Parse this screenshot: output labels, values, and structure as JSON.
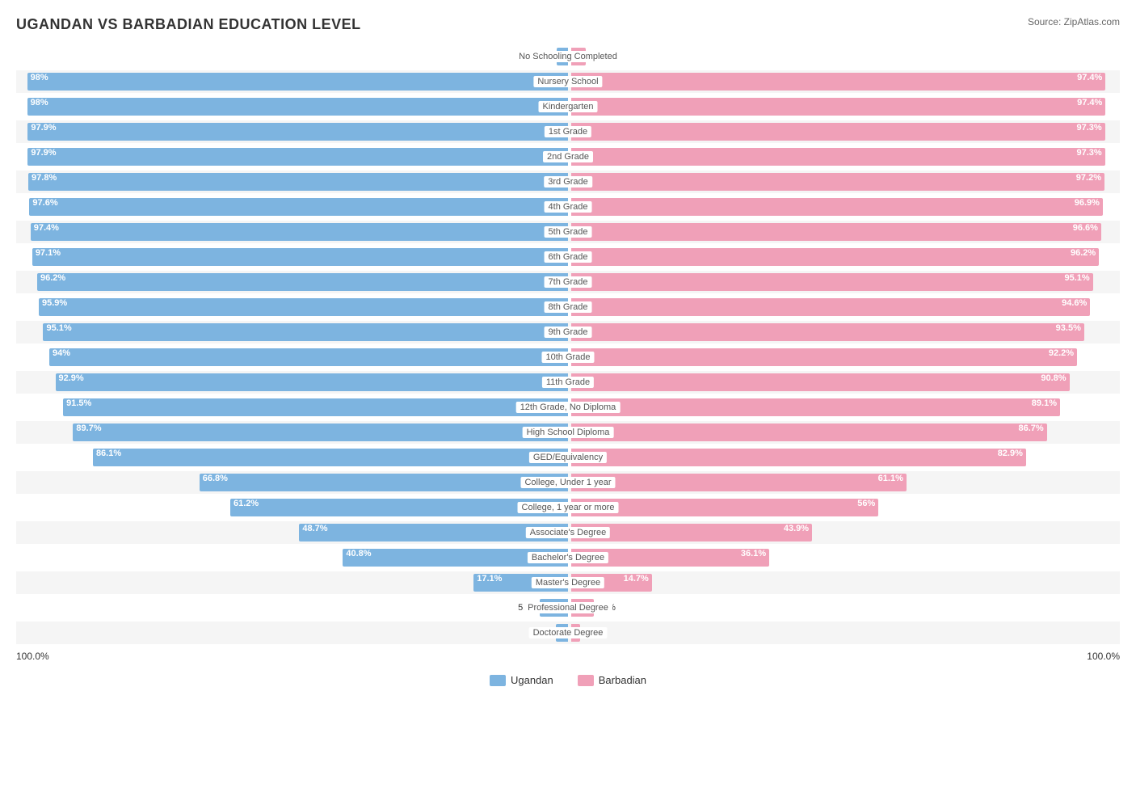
{
  "title": "UGANDAN VS BARBADIAN EDUCATION LEVEL",
  "source": "Source: ZipAtlas.com",
  "legend": {
    "ugandan_label": "Ugandan",
    "barbadian_label": "Barbadian",
    "ugandan_color": "#7db4e0",
    "barbadian_color": "#f0a0b8"
  },
  "axis": {
    "left": "100.0%",
    "right": "100.0%"
  },
  "rows": [
    {
      "label": "No Schooling Completed",
      "ugandan": 2.0,
      "barbadian": 2.6,
      "shaded": false
    },
    {
      "label": "Nursery School",
      "ugandan": 98.0,
      "barbadian": 97.4,
      "shaded": true
    },
    {
      "label": "Kindergarten",
      "ugandan": 98.0,
      "barbadian": 97.4,
      "shaded": false
    },
    {
      "label": "1st Grade",
      "ugandan": 97.9,
      "barbadian": 97.3,
      "shaded": true
    },
    {
      "label": "2nd Grade",
      "ugandan": 97.9,
      "barbadian": 97.3,
      "shaded": false
    },
    {
      "label": "3rd Grade",
      "ugandan": 97.8,
      "barbadian": 97.2,
      "shaded": true
    },
    {
      "label": "4th Grade",
      "ugandan": 97.6,
      "barbadian": 96.9,
      "shaded": false
    },
    {
      "label": "5th Grade",
      "ugandan": 97.4,
      "barbadian": 96.6,
      "shaded": true
    },
    {
      "label": "6th Grade",
      "ugandan": 97.1,
      "barbadian": 96.2,
      "shaded": false
    },
    {
      "label": "7th Grade",
      "ugandan": 96.2,
      "barbadian": 95.1,
      "shaded": true
    },
    {
      "label": "8th Grade",
      "ugandan": 95.9,
      "barbadian": 94.6,
      "shaded": false
    },
    {
      "label": "9th Grade",
      "ugandan": 95.1,
      "barbadian": 93.5,
      "shaded": true
    },
    {
      "label": "10th Grade",
      "ugandan": 94.0,
      "barbadian": 92.2,
      "shaded": false
    },
    {
      "label": "11th Grade",
      "ugandan": 92.9,
      "barbadian": 90.8,
      "shaded": true
    },
    {
      "label": "12th Grade, No Diploma",
      "ugandan": 91.5,
      "barbadian": 89.1,
      "shaded": false
    },
    {
      "label": "High School Diploma",
      "ugandan": 89.7,
      "barbadian": 86.7,
      "shaded": true
    },
    {
      "label": "GED/Equivalency",
      "ugandan": 86.1,
      "barbadian": 82.9,
      "shaded": false
    },
    {
      "label": "College, Under 1 year",
      "ugandan": 66.8,
      "barbadian": 61.1,
      "shaded": true
    },
    {
      "label": "College, 1 year or more",
      "ugandan": 61.2,
      "barbadian": 56.0,
      "shaded": false
    },
    {
      "label": "Associate's Degree",
      "ugandan": 48.7,
      "barbadian": 43.9,
      "shaded": true
    },
    {
      "label": "Bachelor's Degree",
      "ugandan": 40.8,
      "barbadian": 36.1,
      "shaded": false
    },
    {
      "label": "Master's Degree",
      "ugandan": 17.1,
      "barbadian": 14.7,
      "shaded": true
    },
    {
      "label": "Professional Degree",
      "ugandan": 5.1,
      "barbadian": 4.1,
      "shaded": false
    },
    {
      "label": "Doctorate Degree",
      "ugandan": 2.2,
      "barbadian": 1.6,
      "shaded": true
    }
  ]
}
